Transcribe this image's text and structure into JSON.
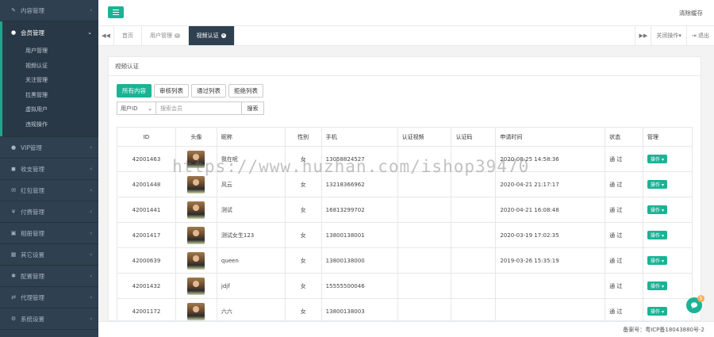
{
  "sidebar": {
    "items": [
      {
        "icon": "edit-icon",
        "glyph": "✎",
        "label": "内容管理"
      },
      {
        "icon": "user-icon",
        "glyph": "●",
        "label": "会员管理",
        "active": true,
        "children": [
          "用户管理",
          "视频认证",
          "关注管理",
          "拉黑管理",
          "虚拟用户",
          "违规操作"
        ]
      },
      {
        "icon": "user-icon",
        "glyph": "●",
        "label": "VIP管理"
      },
      {
        "icon": "wallet-icon",
        "glyph": "◼",
        "label": "收支管理"
      },
      {
        "icon": "envelope-icon",
        "glyph": "✉",
        "label": "红包管理"
      },
      {
        "icon": "money-icon",
        "glyph": "¥",
        "label": "付费管理"
      },
      {
        "icon": "image-icon",
        "glyph": "▣",
        "label": "相册管理"
      },
      {
        "icon": "grid-icon",
        "glyph": "▦",
        "label": "其它设置"
      },
      {
        "icon": "gear-icon",
        "glyph": "✱",
        "label": "配置管理"
      },
      {
        "icon": "exchange-icon",
        "glyph": "⇄",
        "label": "代理管理"
      },
      {
        "icon": "cogs-icon",
        "glyph": "⚙",
        "label": "系统设置"
      },
      {
        "icon": "edit-icon",
        "glyph": "✎",
        "label": "问题管理"
      }
    ],
    "arrow": "‹",
    "arrow_open": "⌄"
  },
  "topbar": {
    "menu_icon": "hamburger-icon",
    "clear_cache": "清除缓存"
  },
  "tabs": {
    "back_glyph": "◀◀",
    "fwd_glyph": "▶▶",
    "items": [
      {
        "label": "首页",
        "closable": false,
        "active": false
      },
      {
        "label": "用户管理",
        "closable": true,
        "active": false
      },
      {
        "label": "视频认证",
        "closable": true,
        "active": true
      }
    ],
    "close_ops": "关闭操作▾",
    "logout": "⇥ 退出"
  },
  "panel": {
    "title": "视频认证",
    "filters": [
      "所有内容",
      "审核列表",
      "通过列表",
      "拒绝列表"
    ],
    "search": {
      "field": "用户ID",
      "caret": "⌄",
      "placeholder": "搜索会员",
      "button": "搜索"
    }
  },
  "table": {
    "headers": [
      "ID",
      "头像",
      "昵称",
      "性别",
      "手机",
      "认证视频",
      "认证码",
      "申请时间",
      "状态",
      "管理"
    ],
    "op_label": "操作 ▾",
    "rows": [
      {
        "id": "42001463",
        "nick": "我在呢",
        "gender": "女",
        "phone": "13058824527",
        "time": "2020-08-25 14:58:36",
        "status": "通 过"
      },
      {
        "id": "42001448",
        "nick": "风云",
        "gender": "女",
        "phone": "13218366962",
        "time": "2020-04-21 21:17:17",
        "status": "通 过"
      },
      {
        "id": "42001441",
        "nick": "测试",
        "gender": "女",
        "phone": "16813299702",
        "time": "2020-04-21 16:08:48",
        "status": "通 过"
      },
      {
        "id": "42001417",
        "nick": "测试女生123",
        "gender": "女",
        "phone": "13800138001",
        "time": "2020-03-19 17:02:35",
        "status": "通 过"
      },
      {
        "id": "42000639",
        "nick": "queen",
        "gender": "女",
        "phone": "13800138000",
        "time": "2019-03-26 15:35:19",
        "status": "通 过"
      },
      {
        "id": "42001432",
        "nick": "jdjf",
        "gender": "女",
        "phone": "15555500046",
        "time": "",
        "status": "通 过"
      },
      {
        "id": "42001172",
        "nick": "六六",
        "gender": "女",
        "phone": "13800138003",
        "time": "",
        "status": "通 过"
      }
    ]
  },
  "watermark": "https://www.huzhan.com/ishop39470",
  "chat": {
    "badge": "5"
  },
  "footer": {
    "icp": "备案号：粤ICP备18043880号-2"
  },
  "colors": {
    "sidebar": "#2f4050",
    "accent": "#1ab394",
    "badge": "#f8ac59"
  }
}
